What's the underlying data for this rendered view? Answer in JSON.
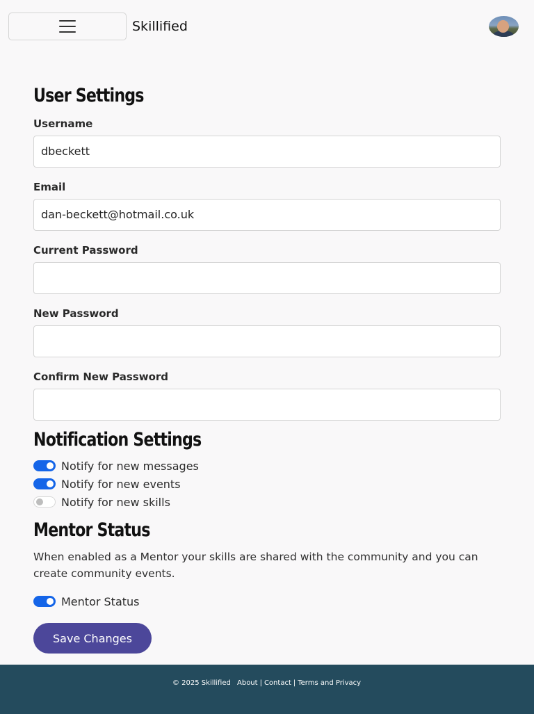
{
  "header": {
    "brand": "Skillified",
    "menu_icon": "hamburger-icon",
    "avatar_icon": "user-avatar"
  },
  "user_settings": {
    "title": "User Settings",
    "fields": [
      {
        "label": "Username",
        "value": "dbeckett",
        "placeholder": ""
      },
      {
        "label": "Email",
        "value": "dan-beckett@hotmail.co.uk",
        "placeholder": ""
      },
      {
        "label": "Current Password",
        "value": "",
        "placeholder": ""
      },
      {
        "label": "New Password",
        "value": "",
        "placeholder": ""
      },
      {
        "label": "Confirm New Password",
        "value": "",
        "placeholder": ""
      }
    ]
  },
  "notification_settings": {
    "title": "Notification Settings",
    "toggles": [
      {
        "label": "Notify for new messages",
        "on": true
      },
      {
        "label": "Notify for new events",
        "on": true
      },
      {
        "label": "Notify for new skills",
        "on": false
      }
    ]
  },
  "mentor": {
    "title": "Mentor Status",
    "description": "When enabled as a Mentor your skills are shared with the community and you can create community events.",
    "toggle_label": "Mentor Status",
    "toggle_on": true
  },
  "actions": {
    "save_label": "Save Changes"
  },
  "footer": {
    "copyright": "© 2025 Skillified",
    "about": "About",
    "contact": "Contact",
    "terms": "Terms and Privacy",
    "separator": "|"
  },
  "colors": {
    "accent": "#1565e8",
    "button": "#4c479a",
    "footer": "#244b5d"
  }
}
